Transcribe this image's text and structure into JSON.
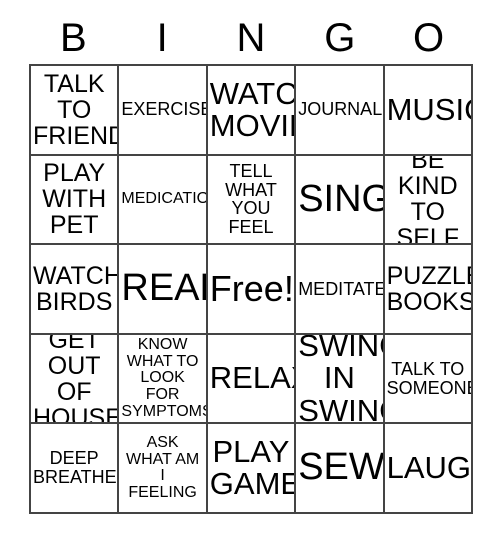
{
  "card": {
    "header_letters": [
      "B",
      "I",
      "N",
      "G",
      "O"
    ],
    "rows": [
      [
        {
          "text": "TALK\nTO\nFRIEND",
          "size": "md",
          "free": false
        },
        {
          "text": "EXERCISE",
          "size": "sm",
          "free": false
        },
        {
          "text": "WATCH\nMOVIE",
          "size": "lg",
          "free": false
        },
        {
          "text": "JOURNAL",
          "size": "sm",
          "free": false
        },
        {
          "text": "MUSIC",
          "size": "lg",
          "free": false
        }
      ],
      [
        {
          "text": "PLAY\nWITH\nPET",
          "size": "md",
          "free": false
        },
        {
          "text": "MEDICATION",
          "size": "xs",
          "free": false
        },
        {
          "text": "TELL\nWHAT\nYOU\nFEEL",
          "size": "sm",
          "free": false
        },
        {
          "text": "SING",
          "size": "xl",
          "free": false
        },
        {
          "text": "BE KIND\nTO\nSELF",
          "size": "md",
          "free": false
        }
      ],
      [
        {
          "text": "WATCH\nBIRDS",
          "size": "md",
          "free": false
        },
        {
          "text": "READ",
          "size": "xl",
          "free": false
        },
        {
          "text": "Free!",
          "size": "lg",
          "free": true
        },
        {
          "text": "MEDITATE",
          "size": "sm",
          "free": false
        },
        {
          "text": "PUZZLE\nBOOKS",
          "size": "md",
          "free": false
        }
      ],
      [
        {
          "text": "GET OUT\nOF\nHOUSE",
          "size": "md",
          "free": false
        },
        {
          "text": "KNOW\nWHAT TO\nLOOK FOR\nSYMPTOMS",
          "size": "xs",
          "free": false
        },
        {
          "text": "RELAX",
          "size": "lg",
          "free": false
        },
        {
          "text": "SWING\nIN\nSWING",
          "size": "lg",
          "free": false
        },
        {
          "text": "TALK TO\nSOMEONE",
          "size": "sm",
          "free": false
        }
      ],
      [
        {
          "text": "DEEP\nBREATHE",
          "size": "sm",
          "free": false
        },
        {
          "text": "ASK\nWHAT AM\nI\nFEELING",
          "size": "xs",
          "free": false
        },
        {
          "text": "PLAY\nGAME",
          "size": "lg",
          "free": false
        },
        {
          "text": "SEW",
          "size": "xl",
          "free": false
        },
        {
          "text": "LAUGH",
          "size": "lg",
          "free": false
        }
      ]
    ]
  }
}
